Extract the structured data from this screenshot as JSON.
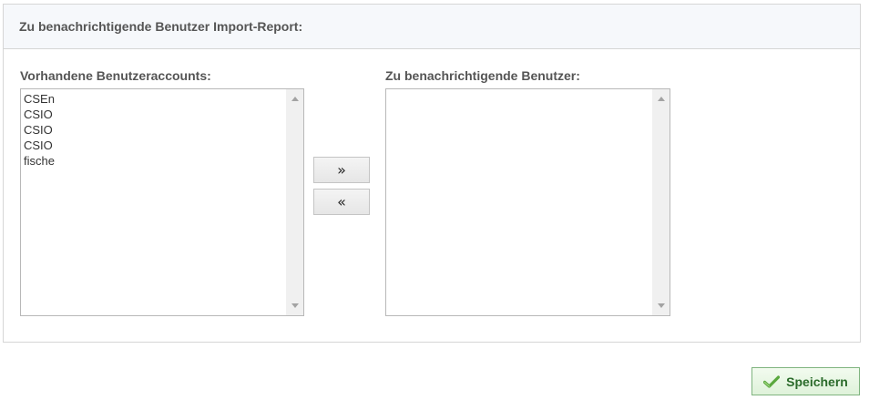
{
  "panel": {
    "title": "Zu benachrichtigende Benutzer Import-Report:"
  },
  "available": {
    "label": "Vorhandene Benutzeraccounts:",
    "items": [
      "CSEn",
      "CSIO",
      "CSIO",
      "CSIO",
      "fische"
    ]
  },
  "selected": {
    "label": "Zu benachrichtigende Benutzer:",
    "items": []
  },
  "buttons": {
    "add": "»",
    "remove": "«",
    "save": "Speichern"
  },
  "icons": {
    "save": "checkmark-icon"
  },
  "colors": {
    "save_text": "#2b6b2b",
    "save_border": "#7fb47f",
    "header_bg": "#f6f8fb"
  }
}
